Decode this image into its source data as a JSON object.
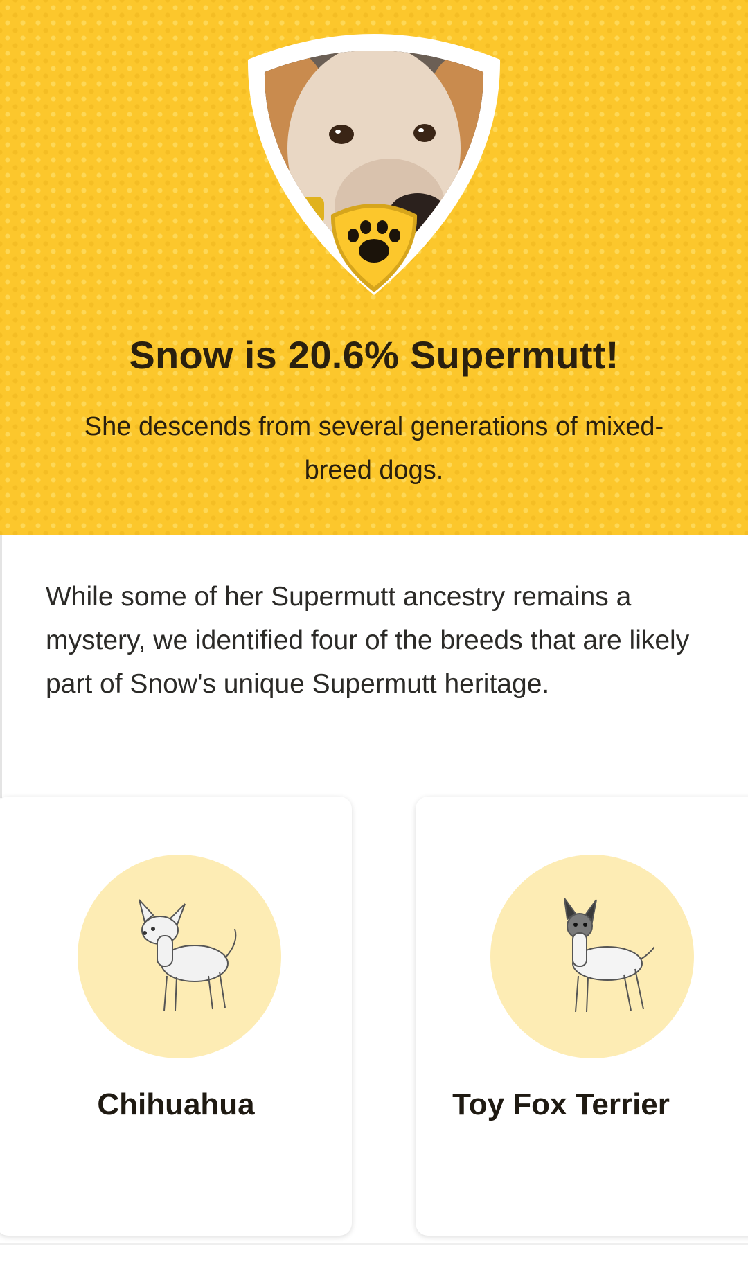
{
  "hero": {
    "title": "Snow is 20.6% Supermutt!",
    "subtitle": "She descends from several generations of mixed-breed dogs.",
    "badge_icon": "paw-icon",
    "background_color": "#fcc72c"
  },
  "intro": {
    "text": "While some of her Supermutt ancestry remains a mystery, we identified four of the breeds that are likely part of Snow's unique Supermutt heritage."
  },
  "breeds": [
    {
      "name": "Chihuahua",
      "icon": "chihuahua-illustration"
    },
    {
      "name": "Toy Fox Terrier",
      "icon": "toy-fox-terrier-illustration"
    }
  ],
  "colors": {
    "accent_yellow": "#fcc72c",
    "circle_bg": "#fdecb4",
    "text_dark": "#1f1a12"
  }
}
